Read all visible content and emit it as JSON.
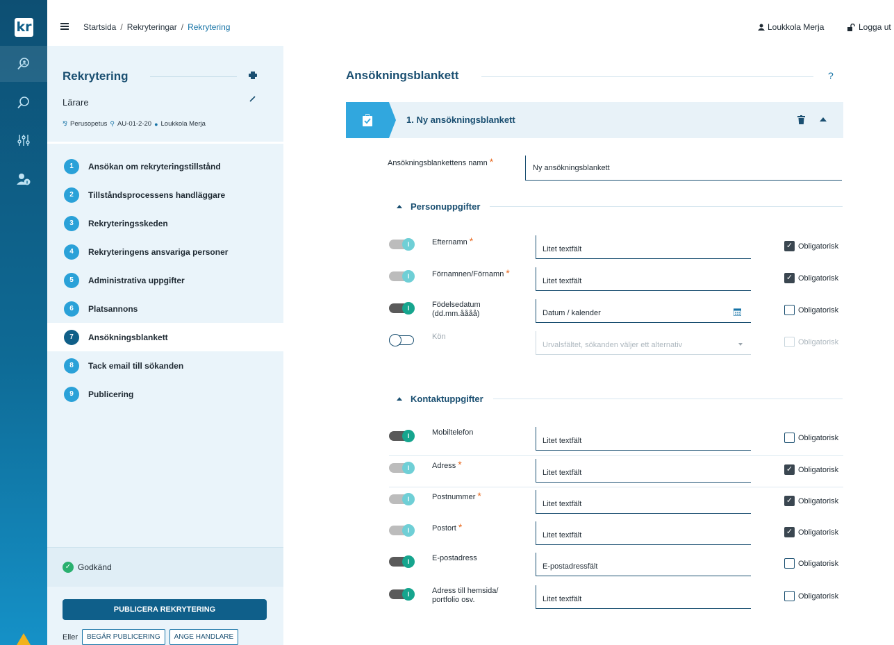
{
  "app": {
    "logo_text": "kr"
  },
  "topbar": {
    "breadcrumbs": [
      "Startsida",
      "Rekryteringar",
      "Rekrytering"
    ],
    "separator": "/",
    "user_name": "Loukkola Merja",
    "logout_label": "Logga ut"
  },
  "sidebar": {
    "title": "Rekrytering",
    "subtitle": "Lärare",
    "meta": {
      "unit": "Perusopetus",
      "code": "AU-01-2-20",
      "owner": "Loukkola Merja"
    },
    "steps": [
      {
        "num": "1",
        "label": "Ansökan om rekryteringstillstånd"
      },
      {
        "num": "2",
        "label": "Tillståndsprocessens handläggare"
      },
      {
        "num": "3",
        "label": "Rekryteringsskeden"
      },
      {
        "num": "4",
        "label": "Rekryteringens ansvariga personer"
      },
      {
        "num": "5",
        "label": "Administrativa uppgifter"
      },
      {
        "num": "6",
        "label": "Platsannons"
      },
      {
        "num": "7",
        "label": "Ansökningsblankett"
      },
      {
        "num": "8",
        "label": "Tack email till sökanden"
      },
      {
        "num": "9",
        "label": "Publicering"
      }
    ],
    "active_step": 7,
    "status": "Godkänd",
    "publish_button": "PUBLICERA REKRYTERING",
    "or_label": "Eller",
    "request_button": "BEGÄR PUBLICERING",
    "handler_button": "ANGE HANDLARE"
  },
  "main": {
    "title": "Ansökningsblankett",
    "help": "?",
    "form_title": "1. Ny ansökningsblankett",
    "name_label": "Ansökningsblankettens namn",
    "name_value": "Ny ansökningsblankett",
    "required_mark": "*",
    "obligatory_label": "Obligatorisk",
    "sections": [
      {
        "title": "Personuppgifter",
        "fields": [
          {
            "label": "Efternamn",
            "required": true,
            "toggle": "locked",
            "input": "Litet textfält",
            "obligatory": true
          },
          {
            "label": "Förnamnen/Förnamn",
            "required": true,
            "toggle": "locked",
            "input": "Litet textfält",
            "obligatory": true
          },
          {
            "label": "Födelsedatum (dd.mm.åååå)",
            "required": false,
            "toggle": "on",
            "input": "Datum / kalender",
            "obligatory": false
          },
          {
            "label": "Kön",
            "required": false,
            "toggle": "off",
            "input": "Urvalsfältet, sökanden väljer ett alternativ",
            "obligatory": false
          }
        ]
      },
      {
        "title": "Kontaktuppgifter",
        "fields": [
          {
            "label": "Mobiltelefon",
            "required": false,
            "toggle": "on",
            "input": "Litet textfält",
            "obligatory": false
          },
          {
            "label": "Adress",
            "required": true,
            "toggle": "locked",
            "input": "Litet textfält",
            "obligatory": true
          },
          {
            "label": "Postnummer",
            "required": true,
            "toggle": "locked",
            "input": "Litet textfält",
            "obligatory": true
          },
          {
            "label": "Postort",
            "required": true,
            "toggle": "locked",
            "input": "Litet textfält",
            "obligatory": true
          },
          {
            "label": "E-postadress",
            "required": false,
            "toggle": "on",
            "input": "E-postadressfält",
            "obligatory": false
          },
          {
            "label": "Adress till hemsida/ portfolio osv.",
            "required": false,
            "toggle": "on",
            "input": "Litet textfält",
            "obligatory": false
          }
        ]
      }
    ]
  },
  "icons": {
    "rail": [
      "search-person-icon",
      "search-icon",
      "sliders-icon",
      "user-info-icon",
      "warning-icon"
    ],
    "toggle_knob": "I"
  },
  "colors": {
    "accent": "#1673a6",
    "primary": "#0f5f8a",
    "required": "#e8661b",
    "approved": "#2ab06f"
  }
}
